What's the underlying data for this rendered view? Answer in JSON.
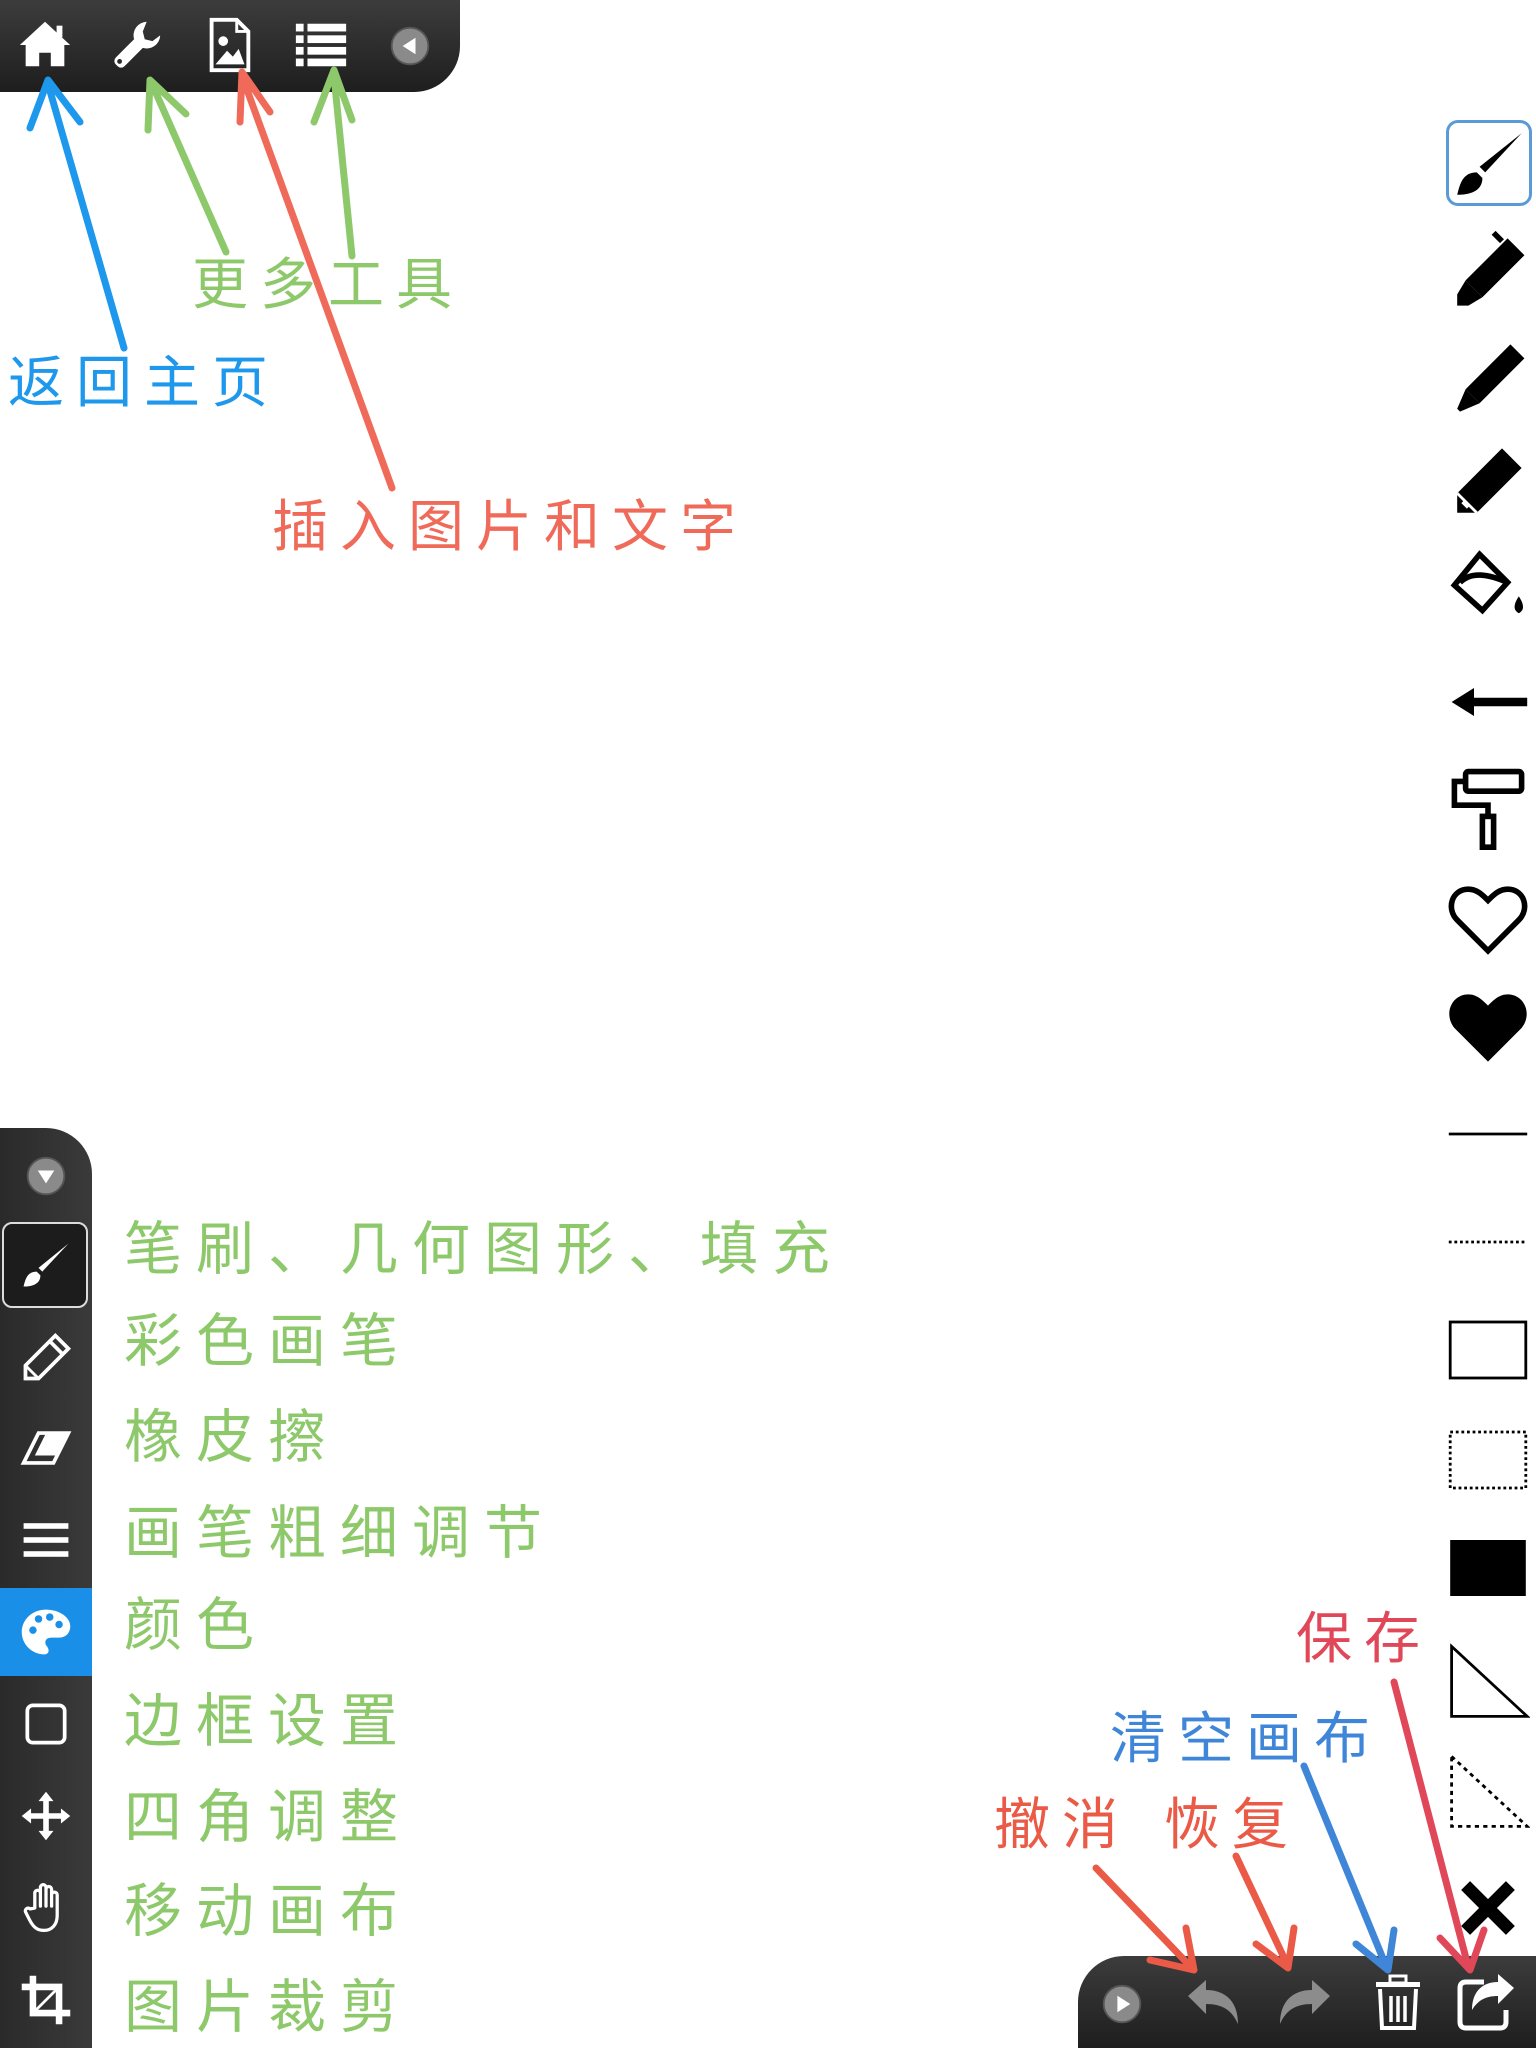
{
  "top_toolbar": {
    "buttons": [
      {
        "name": "home-button",
        "icon": "home-icon"
      },
      {
        "name": "tools-button",
        "icon": "wrench-icon"
      },
      {
        "name": "insert-image-button",
        "icon": "image-file-icon"
      },
      {
        "name": "list-button",
        "icon": "list-icon"
      },
      {
        "name": "collapse-button",
        "icon": "triangle-left-icon"
      }
    ]
  },
  "left_panel": {
    "buttons": [
      {
        "name": "collapse",
        "icon": "triangle-down-icon"
      },
      {
        "name": "brush",
        "icon": "brush-icon",
        "selected": true
      },
      {
        "name": "color-pen",
        "icon": "pencil-icon"
      },
      {
        "name": "eraser",
        "icon": "eraser-icon"
      },
      {
        "name": "stroke-width",
        "icon": "lines-icon"
      },
      {
        "name": "color",
        "icon": "palette-icon",
        "active": true
      },
      {
        "name": "border",
        "icon": "square-icon"
      },
      {
        "name": "corner-adjust",
        "icon": "move-arrows-icon"
      },
      {
        "name": "move-canvas",
        "icon": "hand-icon"
      },
      {
        "name": "crop",
        "icon": "crop-icon"
      }
    ]
  },
  "right_palette": {
    "items": [
      {
        "icon": "brush-icon",
        "selected": true
      },
      {
        "icon": "marker-icon"
      },
      {
        "icon": "pen-icon"
      },
      {
        "icon": "pencil-icon"
      },
      {
        "icon": "paint-bucket-icon"
      },
      {
        "icon": "arrow-left-icon"
      },
      {
        "icon": "paint-roller-icon"
      },
      {
        "icon": "heart-outline-icon"
      },
      {
        "icon": "heart-filled-icon"
      },
      {
        "icon": "solid-line-icon"
      },
      {
        "icon": "dotted-line-icon"
      },
      {
        "icon": "rectangle-outline-icon"
      },
      {
        "icon": "rectangle-dotted-icon"
      },
      {
        "icon": "rectangle-filled-icon"
      },
      {
        "icon": "triangle-outline-icon"
      },
      {
        "icon": "triangle-dotted-icon"
      },
      {
        "icon": "close-icon"
      }
    ]
  },
  "bottom_toolbar": {
    "buttons": [
      {
        "name": "expand",
        "icon": "triangle-right-icon"
      },
      {
        "name": "undo",
        "icon": "undo-icon"
      },
      {
        "name": "redo",
        "icon": "redo-icon"
      },
      {
        "name": "clear",
        "icon": "trash-icon"
      },
      {
        "name": "save",
        "icon": "share-icon"
      }
    ]
  },
  "annotations": {
    "home": "返回主页",
    "more_tools": "更多工具",
    "insert": "插入图片和文字",
    "clear": "清空画布",
    "save": "保存",
    "undo": "撤消",
    "redo": "恢复"
  },
  "legend": [
    "笔刷、几何图形、填充",
    "彩色画笔",
    "橡皮擦",
    "画笔粗细调节",
    "颜色",
    "边框设置",
    "四角调整",
    "移动画布",
    "图片裁剪"
  ],
  "colors": {
    "toolbar_dark": "#2a2a2a",
    "active_blue": "#1a8fe8",
    "green_note": "#8dc86a",
    "blue_note": "#1e98ec",
    "red_note": "#f06a5a",
    "save_note": "#e0485a",
    "clear_note": "#3f86d8"
  }
}
